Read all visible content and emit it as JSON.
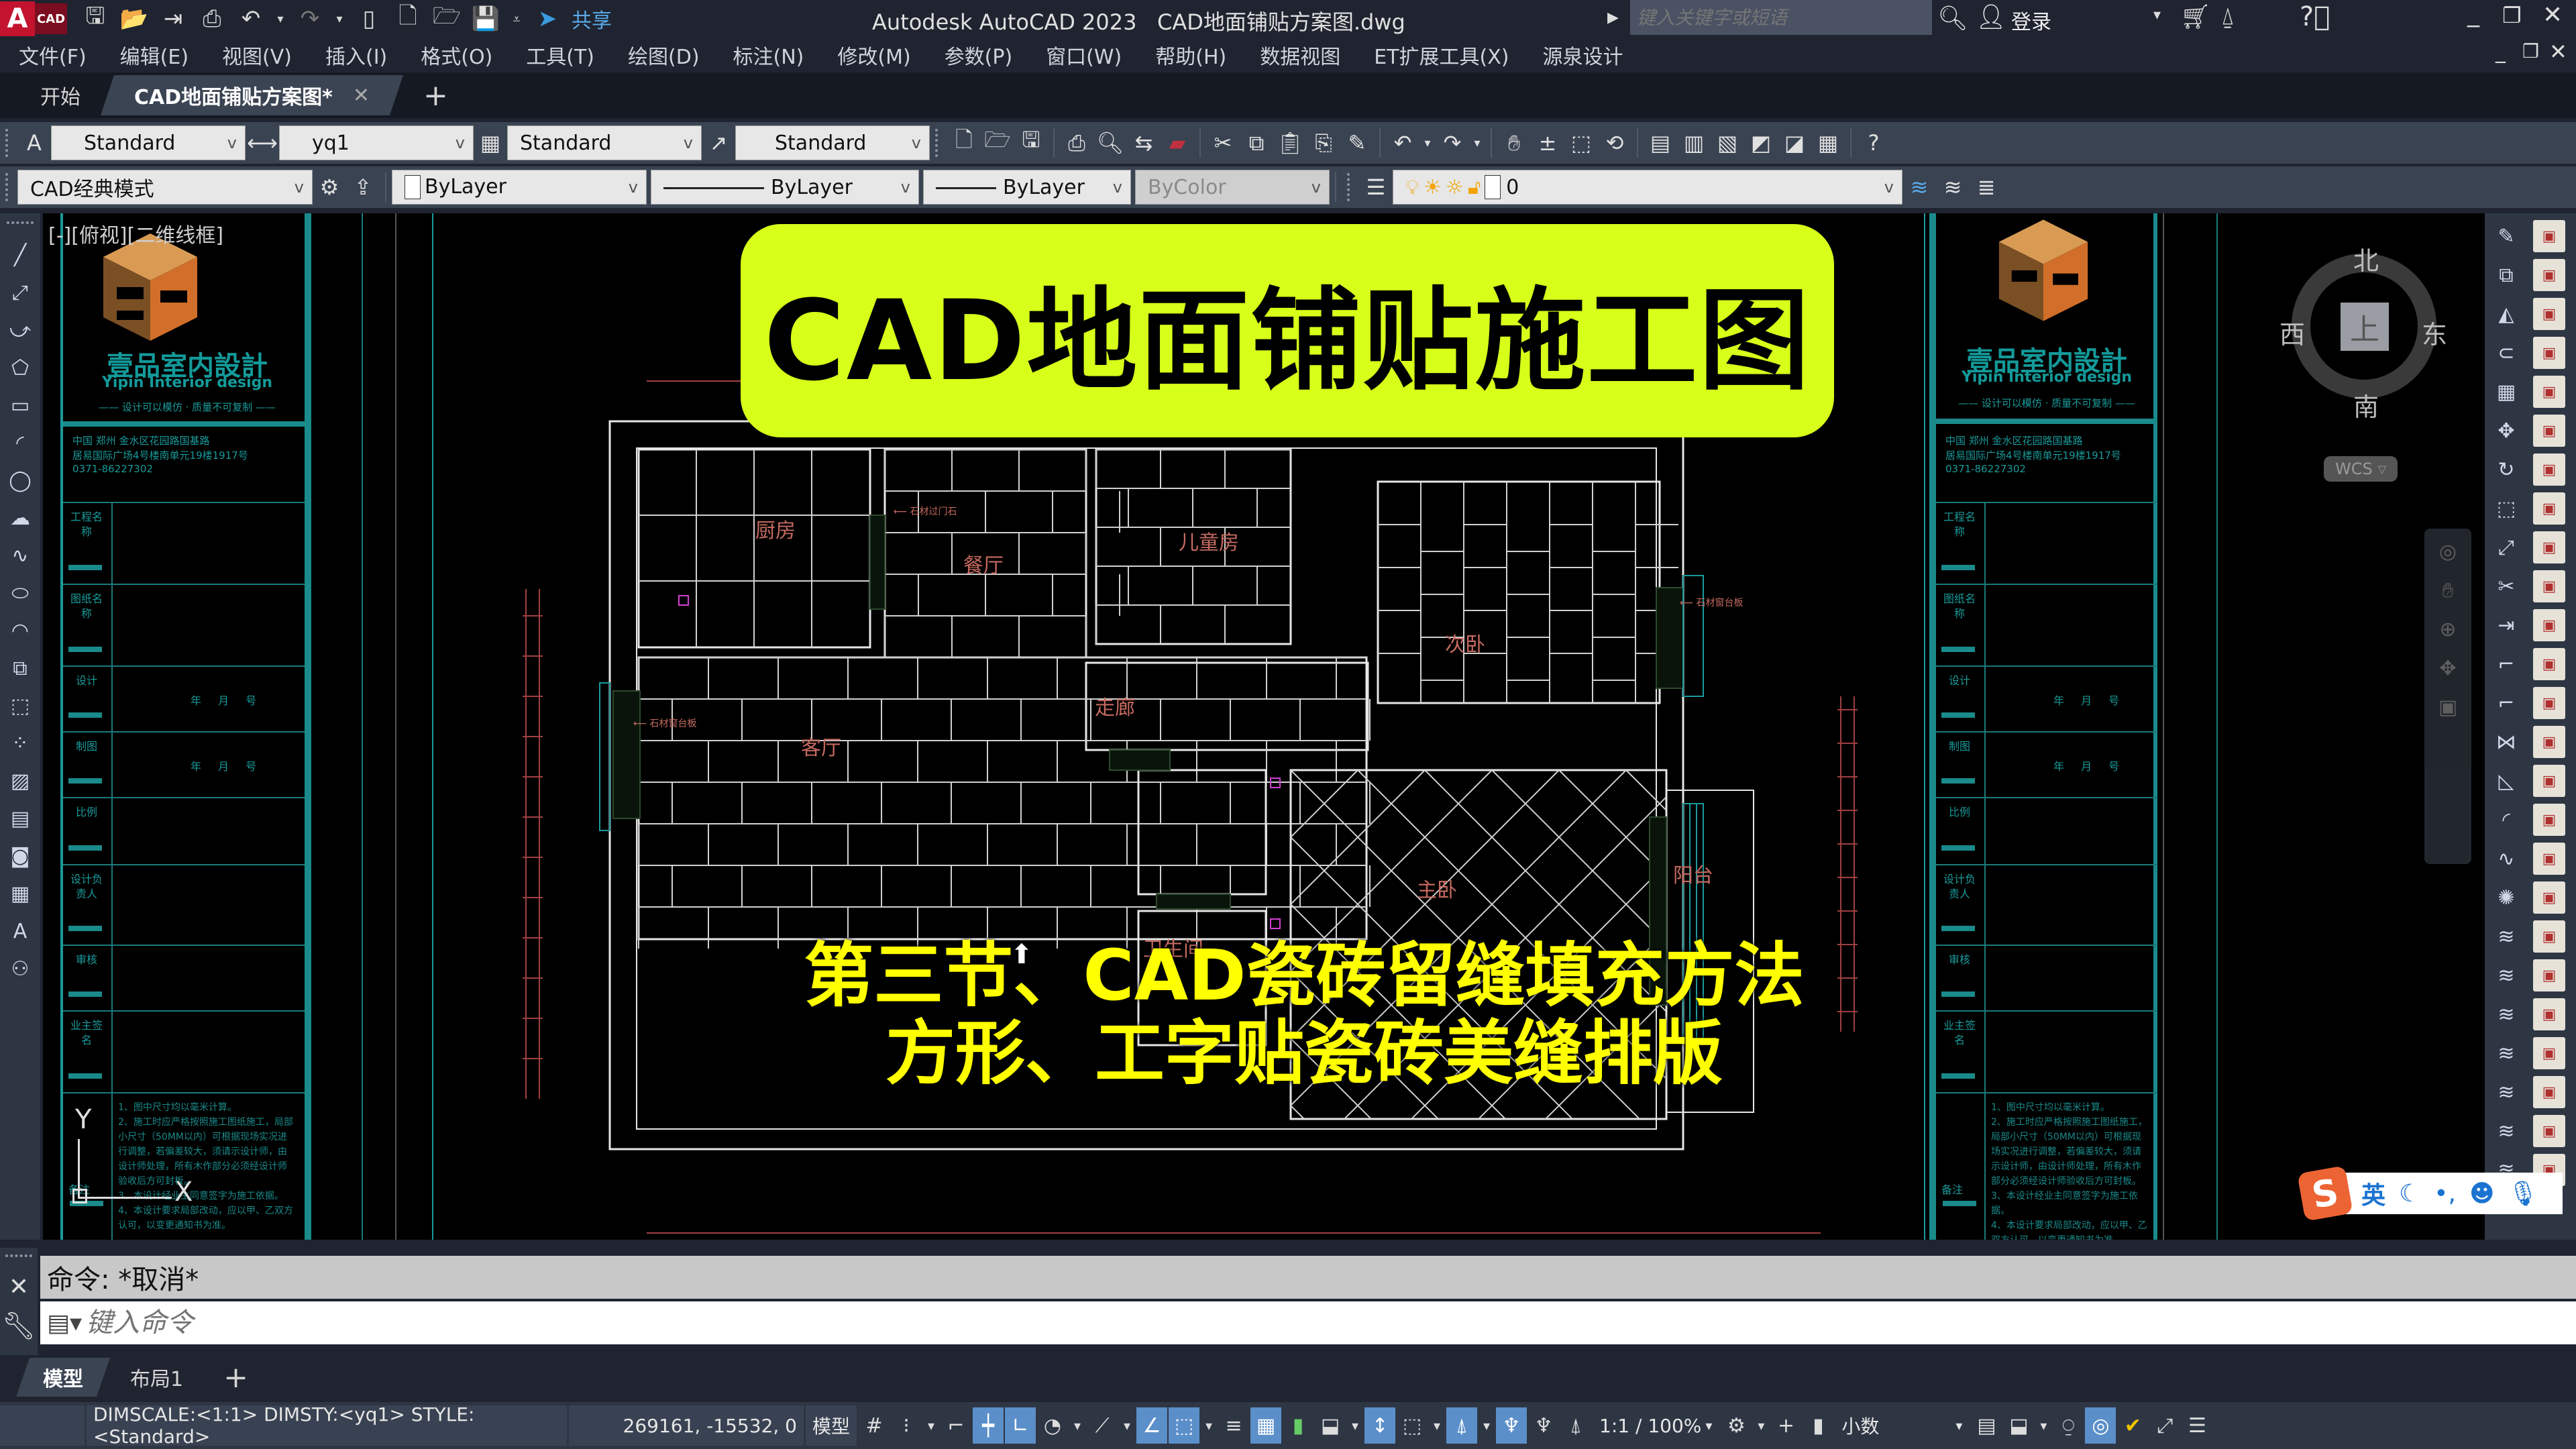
{
  "app": {
    "title": "Autodesk AutoCAD 2023",
    "filename": "CAD地面铺贴方案图.dwg",
    "logo_letter": "A",
    "logo_badge": "CAD",
    "share_label": "共享",
    "search_placeholder": "键入关键字或短语",
    "login_label": "登录"
  },
  "quick_access": [
    "new-save-icon",
    "open-icon",
    "import-icon",
    "print-icon",
    "undo-icon",
    "redo-icon",
    "layout-icon",
    "new-icon",
    "open-folder-icon",
    "save-icon"
  ],
  "menu": [
    "文件(F)",
    "编辑(E)",
    "视图(V)",
    "插入(I)",
    "格式(O)",
    "工具(T)",
    "绘图(D)",
    "标注(N)",
    "修改(M)",
    "参数(P)",
    "窗口(W)",
    "帮助(H)",
    "数据视图",
    "ET扩展工具(X)",
    "源泉设计"
  ],
  "doc_tabs": [
    {
      "label": "开始",
      "active": false
    },
    {
      "label": "CAD地面铺贴方案图*",
      "active": true
    }
  ],
  "toolbar1": {
    "text_style": "Standard",
    "dim_style": "yq1",
    "table_style": "Standard",
    "mleader_style": "Standard"
  },
  "toolbar2": {
    "workspace": "CAD经典模式",
    "color": "ByLayer",
    "linetype": "ByLayer",
    "lineweight": "ByLayer",
    "plotstyle": "ByColor",
    "layer": "0"
  },
  "viewport_label": "[-][俯视][二维线框]",
  "overlay": {
    "title": "CAD地面铺贴施工图",
    "subtitle_line1": "第三节、CAD瓷砖留缝填充方法",
    "subtitle_line2": "方形、工字贴瓷砖美缝排版",
    "banner_color": "#d6ff1a",
    "subtitle_color": "#ffff00"
  },
  "titleblock": {
    "company_cn": "壹品室内設計",
    "company_en": "Yipin Interior design",
    "slogan": "—— 设计可以模仿 · 质量不可复制 ——",
    "address1": "中国 郑州 金水区花园路国基路",
    "address2": "居易国际广场4号楼南单元19楼1917号",
    "phone": "0371-86227302",
    "rows": [
      {
        "label": "工程名称",
        "value": ""
      },
      {
        "label": "图纸名称",
        "value": ""
      },
      {
        "label": "设计",
        "value": "年 月 号"
      },
      {
        "label": "制图",
        "value": "年 月 号"
      },
      {
        "label": "比例",
        "value": ""
      },
      {
        "label": "设计负责人",
        "value": ""
      },
      {
        "label": "审核",
        "value": ""
      },
      {
        "label": "业主签名",
        "value": ""
      }
    ],
    "notes_label": "备注",
    "notes": [
      "1、图中尺寸均以毫米计算。",
      "2、施工时应严格按照施工图纸施工，局部小尺寸（50MM以内）可根据现场实况进行调整，若偏差较大，须请示设计师，由设计师处理，所有木作部分必须经设计师验收后方可封板。",
      "3、本设计经业主同意签字为施工依据。",
      "4、本设计要求局部改动，应以甲、乙双方认可，以变更通知书为准。"
    ]
  },
  "rooms": {
    "kitchen": "厨房",
    "dining": "餐厅",
    "kids": "儿童房",
    "second_bed": "次卧",
    "corridor": "走廊",
    "living": "客厅",
    "master": "主卧",
    "balcony": "阳台",
    "bath": "卫生间"
  },
  "annotations": {
    "door_stone": "石材过门石",
    "sill_left": "石材窗台板",
    "sill_right": "石材窗台板"
  },
  "viewcube": {
    "north": "北",
    "south": "南",
    "east": "东",
    "west": "西",
    "top": "上",
    "wcs": "WCS"
  },
  "ucs": {
    "x": "X",
    "y": "Y"
  },
  "command": {
    "history": "命令: *取消*",
    "placeholder": "键入命令"
  },
  "layout_tabs": [
    {
      "label": "模型",
      "active": true
    },
    {
      "label": "布局1",
      "active": false
    }
  ],
  "status": {
    "info": "DIMSCALE:<1:1> DIMSTY:<yq1> STYLE:<Standard>",
    "coords": "269161, -15532, 0",
    "space": "模型",
    "scale": "1:1 / 100%",
    "units": "小数"
  },
  "ime": {
    "lang": "英"
  }
}
